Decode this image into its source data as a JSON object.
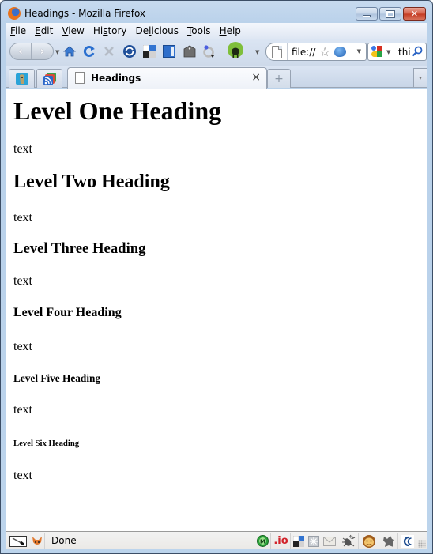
{
  "window": {
    "title": "Headings - Mozilla Firefox",
    "controls": {
      "minimize": "minimize",
      "maximize": "maximize",
      "close": "close"
    }
  },
  "menubar": {
    "items": [
      {
        "label": "File",
        "accel": "F",
        "rest": "ile"
      },
      {
        "label": "Edit",
        "accel": "E",
        "rest": "dit"
      },
      {
        "label": "View",
        "accel": "V",
        "rest": "iew"
      },
      {
        "label": "History",
        "pre": "Hi",
        "accel": "s",
        "rest": "tory"
      },
      {
        "label": "Delicious",
        "pre": "De",
        "accel": "l",
        "rest": "icious"
      },
      {
        "label": "Tools",
        "accel": "T",
        "rest": "ools"
      },
      {
        "label": "Help",
        "accel": "H",
        "rest": "elp"
      }
    ]
  },
  "toolbar": {
    "back_glyph": "‹",
    "forward_glyph": "›",
    "icons": [
      "home-icon",
      "reload-icon",
      "stop-icon",
      "sync-icon",
      "delicious-icon",
      "sidebar-icon",
      "bookmark-tag-icon",
      "notifier-icon",
      "greasemonkey-icon"
    ],
    "url": "file://",
    "search_text": "thi"
  },
  "tabs": {
    "app_tabs": [
      "app-tab-1",
      "app-tab-feeds"
    ],
    "active": {
      "title": "Headings",
      "close_glyph": "×"
    },
    "new_tab_glyph": "+",
    "list_glyph": "▾"
  },
  "page": {
    "h1": "Level One Heading",
    "h2": "Level Two Heading",
    "h3": "Level Three Heading",
    "h4": "Level Four Heading",
    "h5": "Level Five Heading",
    "h6": "Level Six Heading",
    "paragraphs": [
      "text",
      "text",
      "text",
      "text",
      "text",
      "text"
    ]
  },
  "statusbar": {
    "status": "Done",
    "addon_io_label": ".io",
    "m_label": "M"
  },
  "colors": {
    "frame": "#bcd4ec",
    "close_button": "#c43a22",
    "io_red": "#d2232a",
    "m_green": "#2ba03a"
  }
}
